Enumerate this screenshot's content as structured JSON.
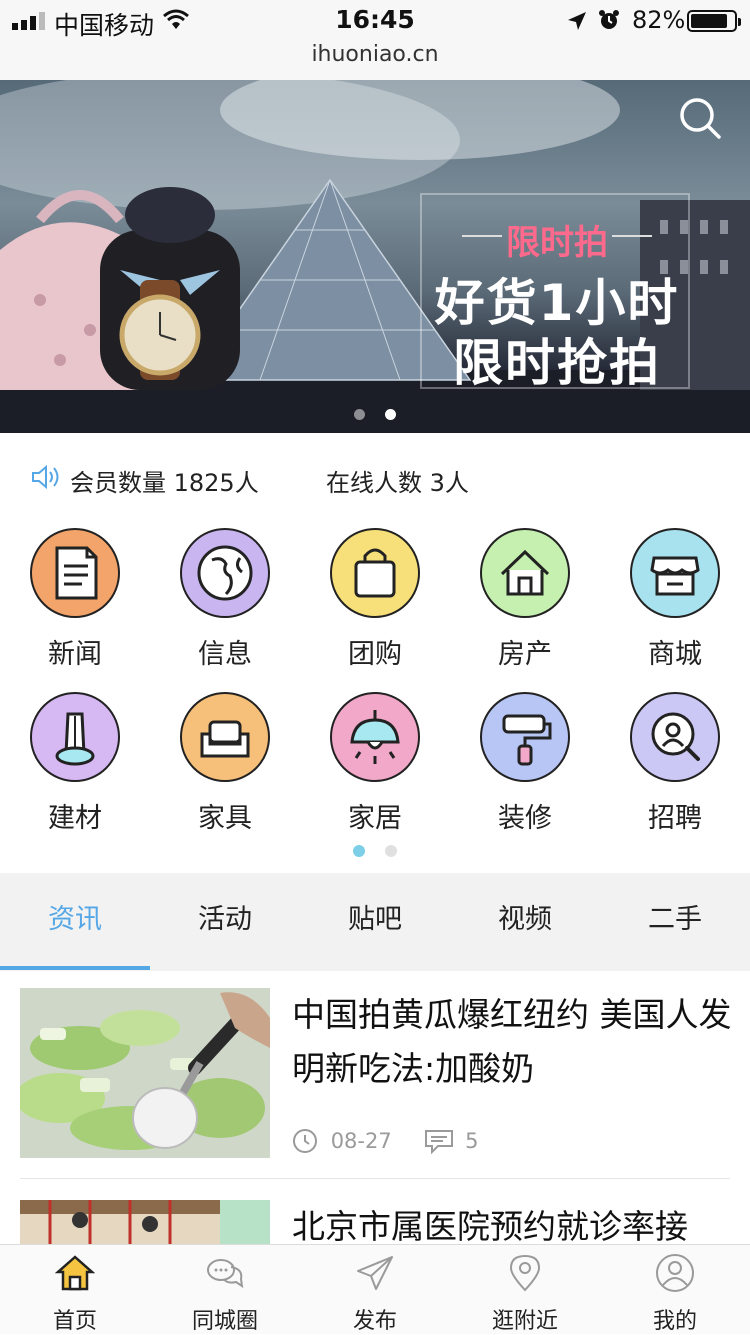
{
  "status_bar": {
    "carrier": "中国移动",
    "time": "16:45",
    "url": "ihuoniao.cn",
    "battery": "82%"
  },
  "banner": {
    "tag": "限时拍",
    "line1": "好货1小时",
    "line2": "限时抢拍",
    "slide_count": 2,
    "active_slide": 2
  },
  "stats": {
    "members": "会员数量 1825人",
    "online": "在线人数 3人"
  },
  "categories": [
    {
      "label": "新闻",
      "icon": "news-icon",
      "color": "#f3a46a"
    },
    {
      "label": "信息",
      "icon": "globe-icon",
      "color": "#c9b6f0"
    },
    {
      "label": "团购",
      "icon": "shopping-bag-icon",
      "color": "#f7e07a"
    },
    {
      "label": "房产",
      "icon": "house-icon",
      "color": "#c6f0b0"
    },
    {
      "label": "商城",
      "icon": "store-icon",
      "color": "#a8e2ee"
    },
    {
      "label": "建材",
      "icon": "building-material-icon",
      "color": "#d6b8f2"
    },
    {
      "label": "家具",
      "icon": "sofa-icon",
      "color": "#f7c07a"
    },
    {
      "label": "家居",
      "icon": "lamp-icon",
      "color": "#f2a8c8"
    },
    {
      "label": "装修",
      "icon": "paint-roller-icon",
      "color": "#b8c6f5"
    },
    {
      "label": "招聘",
      "icon": "recruit-search-icon",
      "color": "#ccc8f5"
    }
  ],
  "tabs": [
    "资讯",
    "活动",
    "贴吧",
    "视频",
    "二手"
  ],
  "active_tab": 0,
  "news": [
    {
      "title": "中国拍黄瓜爆红纽约 美国人发明新吃法:加酸奶",
      "date": "08-27",
      "comments": "5"
    },
    {
      "title": "北京市属医院预约就诊率接"
    }
  ],
  "bottom_nav": [
    {
      "label": "首页",
      "icon": "home-icon"
    },
    {
      "label": "同城圈",
      "icon": "chat-bubbles-icon"
    },
    {
      "label": "发布",
      "icon": "paper-plane-icon"
    },
    {
      "label": "逛附近",
      "icon": "location-pin-icon"
    },
    {
      "label": "我的",
      "icon": "user-icon"
    }
  ],
  "colors": {
    "accent": "#56a7e6",
    "pager_active": "#7ccfe6",
    "promo_tag": "#ff6a8c"
  }
}
